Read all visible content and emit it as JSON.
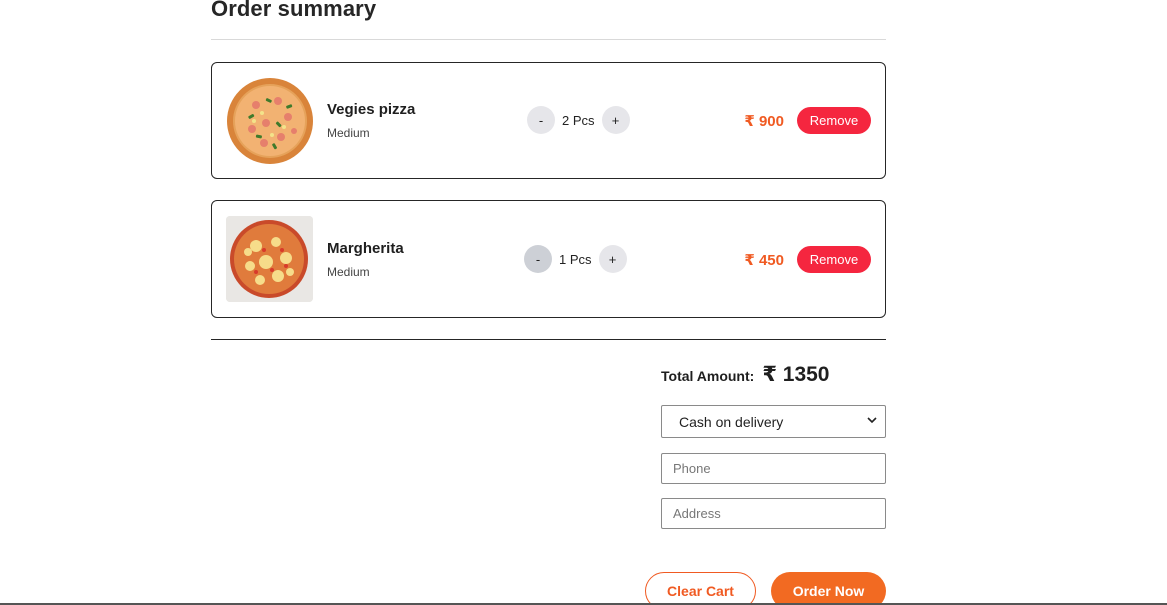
{
  "page": {
    "title": "Order summary"
  },
  "cart": {
    "items": [
      {
        "name": "Vegies pizza",
        "size": "Medium",
        "decrement_label": "-",
        "quantity_label": "2 Pcs",
        "increment_label": "+",
        "price": "₹ 900",
        "remove_label": "Remove",
        "image": "veg-pizza-image"
      },
      {
        "name": "Margherita",
        "size": "Medium",
        "decrement_label": "-",
        "quantity_label": "1 Pcs",
        "increment_label": "+",
        "price": "₹ 450",
        "remove_label": "Remove",
        "image": "margherita-pizza-image"
      }
    ]
  },
  "summary": {
    "total_label": "Total Amount:",
    "total_value": "₹ 1350",
    "payment_method": "Cash on delivery",
    "phone_placeholder": "Phone",
    "address_placeholder": "Address",
    "clear_cart_label": "Clear Cart",
    "order_now_label": "Order Now"
  },
  "colors": {
    "accent": "#f26a22",
    "price": "#f05a22",
    "remove": "#f5263f"
  }
}
